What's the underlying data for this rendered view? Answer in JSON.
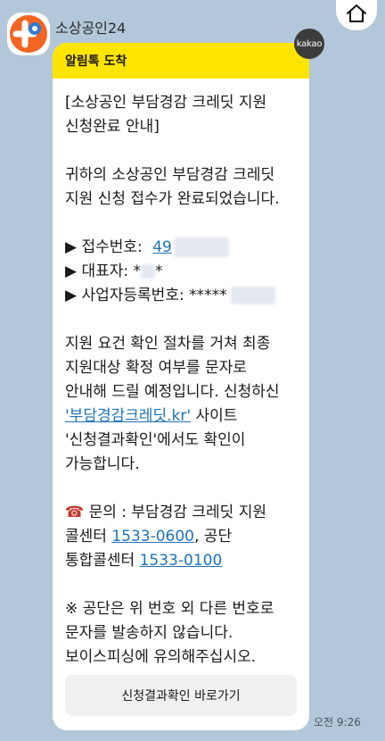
{
  "chat": {
    "sender_name": "소상공인24"
  },
  "header": {
    "label": "알림톡 도착",
    "kakao_badge": "kakao"
  },
  "message": {
    "title_line1": "[소상공인 부담경감 크레딧 지원",
    "title_line2": "신청완료 안내]",
    "intro_line1": "귀하의 소상공인 부담경감 크레딧",
    "intro_line2": "지원 신청 접수가 완료되었습니다.",
    "arrow": "▶",
    "receipt_label": "접수번호:",
    "receipt_value": "49",
    "rep_label": "대표자:",
    "rep_value_prefix": "*",
    "rep_value_suffix": "*",
    "biz_label": "사업자등록번호:",
    "biz_value": "*****",
    "body_line1": "지원 요건 확인 절차를 거쳐 최종",
    "body_line2": "지원대상 확정 여부를 문자로",
    "body_line3": "안내해 드릴 예정입니다. 신청하신",
    "site_link": "'부담경감크레딧.kr'",
    "body_line4_suffix": " 사이트",
    "body_line5": "'신청결과확인'에서도 확인이",
    "body_line6": "가능합니다.",
    "phone_emoji": "☎",
    "inquiry_line1": "문의 : 부담경감 크레딧 지원",
    "callcenter_label": "콜센터",
    "callcenter_phone": "1533-0600",
    "callcenter_suffix": ", 공단",
    "integrated_label": "통합콜센터",
    "integrated_phone": "1533-0100",
    "notice_line1": "※ 공단은 위 번호 외 다른 번호로",
    "notice_line2": "문자를 발송하지 않습니다.",
    "notice_line3": "보이스피싱에 유의해주십시오."
  },
  "action": {
    "button_label": "신청결과확인 바로가기"
  },
  "meta": {
    "time": "오전 9:26"
  },
  "colors": {
    "background": "#b2c7d9",
    "header_yellow": "#fee500",
    "link_blue": "#1d72b8",
    "logo_orange": "#f26522",
    "logo_blue": "#2b7bd6"
  },
  "icons": {
    "home": "home-icon",
    "logo": "sosang24-logo",
    "phone": "phone-icon"
  }
}
